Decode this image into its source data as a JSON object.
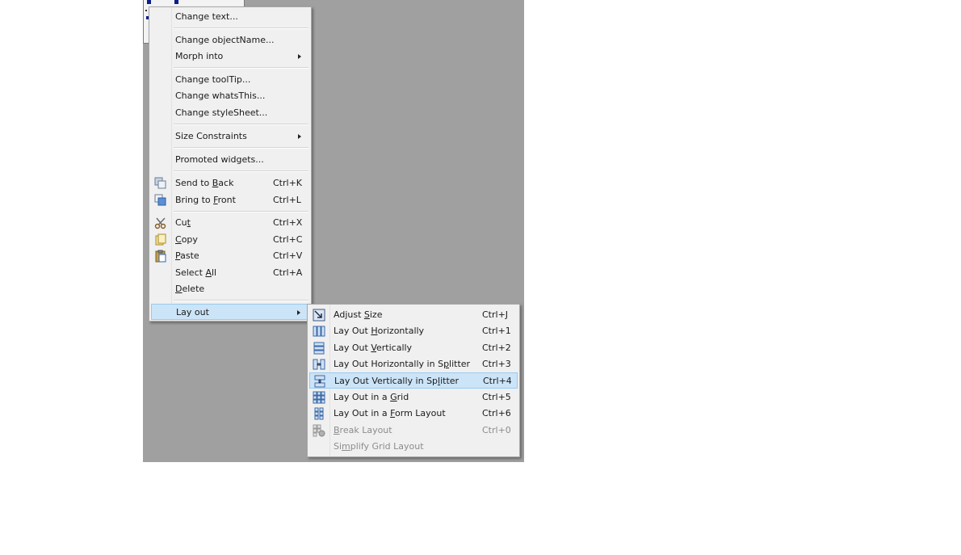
{
  "context_menu": {
    "items": [
      {
        "label": "Change text..."
      },
      {
        "label": "Change objectName..."
      },
      {
        "label": "Morph into"
      },
      {
        "label": "Change toolTip..."
      },
      {
        "label": "Change whatsThis..."
      },
      {
        "label": "Change styleSheet..."
      },
      {
        "label": "Size Constraints"
      },
      {
        "label": "Promoted widgets..."
      },
      {
        "label_pre": "Send to ",
        "label_key": "B",
        "label_post": "ack",
        "shortcut": "Ctrl+K",
        "icon": "send-to-back-icon"
      },
      {
        "label_pre": "Bring to ",
        "label_key": "F",
        "label_post": "ront",
        "shortcut": "Ctrl+L",
        "icon": "bring-to-front-icon"
      },
      {
        "label_pre": "Cu",
        "label_key": "t",
        "label_post": "",
        "shortcut": "Ctrl+X",
        "icon": "scissors-icon"
      },
      {
        "label_pre": "",
        "label_key": "C",
        "label_post": "opy",
        "shortcut": "Ctrl+C",
        "icon": "copy-icon"
      },
      {
        "label_pre": "",
        "label_key": "P",
        "label_post": "aste",
        "shortcut": "Ctrl+V",
        "icon": "paste-icon"
      },
      {
        "label_pre": "Select ",
        "label_key": "A",
        "label_post": "ll",
        "shortcut": "Ctrl+A"
      },
      {
        "label_pre": "",
        "label_key": "D",
        "label_post": "elete"
      },
      {
        "label": "Lay out"
      }
    ]
  },
  "layout_submenu": {
    "items": [
      {
        "label_pre": "Adjust ",
        "label_key": "S",
        "label_post": "ize",
        "shortcut": "Ctrl+J",
        "icon": "adjust-size-icon"
      },
      {
        "label_pre": "Lay Out ",
        "label_key": "H",
        "label_post": "orizontally",
        "shortcut": "Ctrl+1",
        "icon": "layout-horizontal-icon"
      },
      {
        "label_pre": "Lay Out ",
        "label_key": "V",
        "label_post": "ertically",
        "shortcut": "Ctrl+2",
        "icon": "layout-vertical-icon"
      },
      {
        "label_pre": "Lay Out Horizontally in S",
        "label_key": "p",
        "label_post": "litter",
        "shortcut": "Ctrl+3",
        "icon": "splitter-horizontal-icon"
      },
      {
        "label_pre": "Lay Out Vertically in Sp",
        "label_key": "l",
        "label_post": "itter",
        "shortcut": "Ctrl+4",
        "icon": "splitter-vertical-icon"
      },
      {
        "label_pre": "Lay Out in a ",
        "label_key": "G",
        "label_post": "rid",
        "shortcut": "Ctrl+5",
        "icon": "layout-grid-icon"
      },
      {
        "label_pre": "Lay Out in a ",
        "label_key": "F",
        "label_post": "orm Layout",
        "shortcut": "Ctrl+6",
        "icon": "layout-form-icon"
      },
      {
        "label_pre": "",
        "label_key": "B",
        "label_post": "reak Layout",
        "shortcut": "Ctrl+0",
        "icon": "break-layout-icon"
      },
      {
        "label_pre": "Si",
        "label_key": "m",
        "label_post": "plify Grid Layout"
      }
    ]
  },
  "colors": {
    "canvas": "#a0a0a0",
    "menu_bg": "#f0f0f0",
    "highlight": "#cce4f7",
    "highlight_border": "#99c9ef",
    "disabled_text": "#8c8c8c"
  }
}
